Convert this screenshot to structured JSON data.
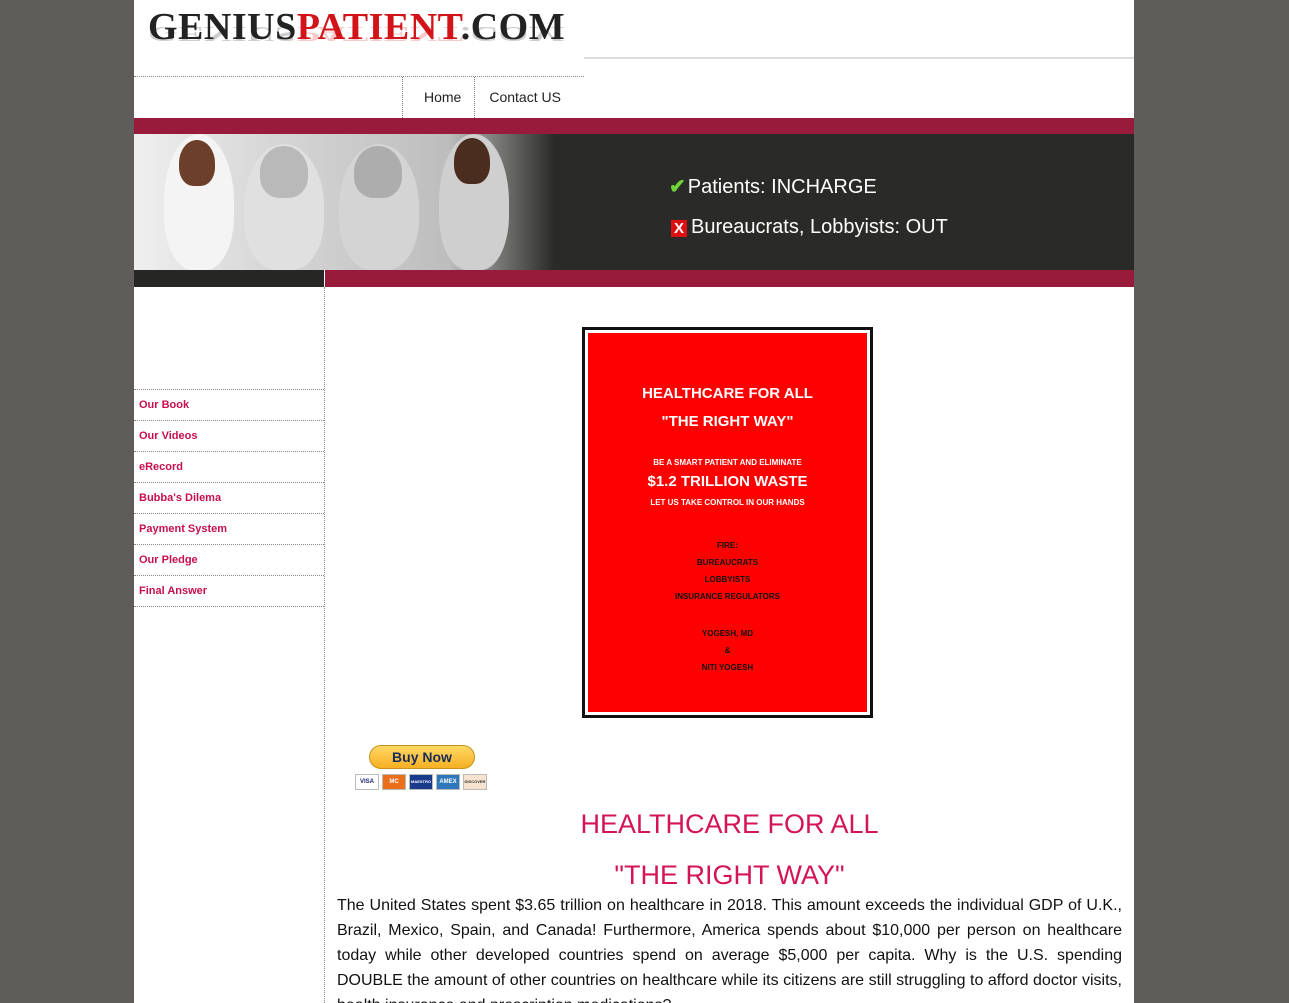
{
  "header": {
    "logo_part1": "GENIUS",
    "logo_part2": "PATIENT",
    "logo_part3": ".COM"
  },
  "nav": [
    {
      "label": "Home"
    },
    {
      "label": "Contact US"
    }
  ],
  "banner": {
    "message1": "Patients: INCHARGE",
    "message2": "Bureaucrats, Lobbyists: OUT",
    "check_icon": "checkmark-icon",
    "cross_icon": "x-mark-icon"
  },
  "sidebar": {
    "items": [
      {
        "label": "Our Book"
      },
      {
        "label": "Our Videos"
      },
      {
        "label": "eRecord"
      },
      {
        "label": "Bubba's Dilema"
      },
      {
        "label": "Payment System"
      },
      {
        "label": "Our Pledge"
      },
      {
        "label": "Final Answer"
      }
    ]
  },
  "book": {
    "title1": "HEALTHCARE FOR ALL",
    "title2": "\"THE RIGHT WAY\"",
    "line1": "BE A SMART PATIENT AND ELIMINATE",
    "big": "$1.2 TRILLION WASTE",
    "line2": "LET US TAKE CONTROL IN OUR HANDS",
    "fire": "FIRE:",
    "fire1": "BUREAUCRATS",
    "fire2": "LOBBYISTS",
    "fire3": "INSURANCE REGULATORS",
    "author1": "YOGESH, MD",
    "amp": "&",
    "author2": "NITI YOGESH"
  },
  "buy": {
    "label": "Buy Now",
    "cards": [
      "VISA",
      "MC",
      "MAESTRO",
      "AMEX",
      "DISCOVER"
    ]
  },
  "content": {
    "heading1": "HEALTHCARE FOR ALL",
    "heading2": "\"THE RIGHT WAY\"",
    "paragraph": "The United States spent $3.65 trillion on healthcare in 2018. This amount exceeds the individual GDP of U.K., Brazil, Mexico, Spain, and Canada! Furthermore, America spends about $10,000 per person on healthcare today while other developed countries spend on average $5,000 per capita. Why is the U.S. spending DOUBLE the amount of other countries on healthcare while its citizens are still struggling to afford doctor visits, health insurance and prescription medications?"
  },
  "colors": {
    "accent": "#981b3c",
    "link": "#c70f4d",
    "heading": "#d41456",
    "book_red": "#ff0000"
  }
}
